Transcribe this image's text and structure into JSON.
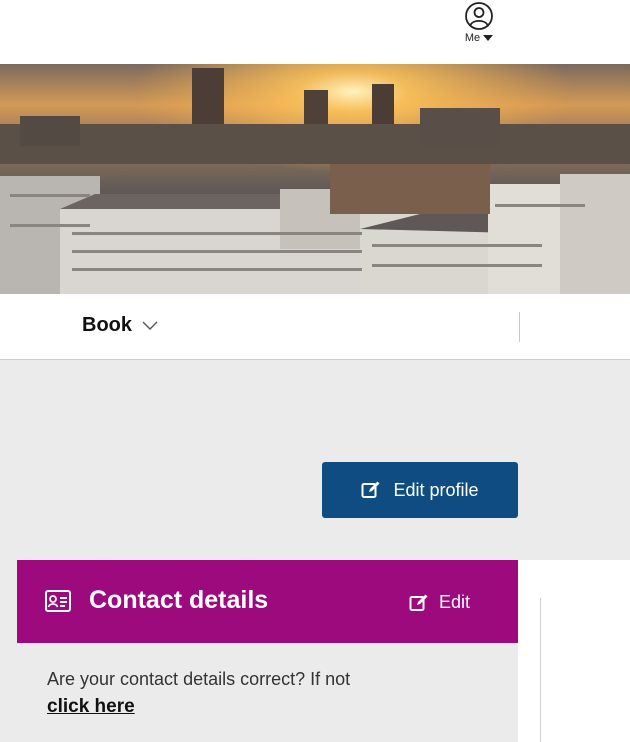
{
  "header": {
    "me_label": "Me",
    "user_icon": "user-circle-icon",
    "caret_icon": "caret-down-icon"
  },
  "hero": {
    "image": "london-skyline-sunset"
  },
  "nav": {
    "book_label": "Book",
    "book_icon": "chevron-down-icon"
  },
  "profile": {
    "edit_profile_label": "Edit profile",
    "edit_icon": "edit-icon"
  },
  "contact_card": {
    "title": "Contact details",
    "title_icon": "contact-card-icon",
    "edit_label": "Edit",
    "body_text": "Are your contact details correct? If not",
    "link_text": "click here"
  },
  "colors": {
    "brand_blue": "#0f4c81",
    "brand_purple": "#9c0a7d",
    "page_grey": "#ebebeb"
  }
}
